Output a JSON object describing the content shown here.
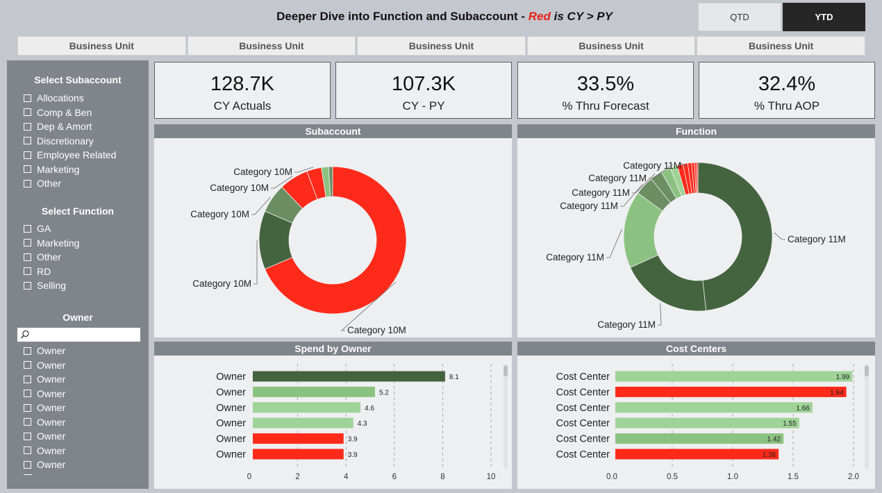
{
  "header": {
    "title_prefix": "Deeper Dive into Function and Subaccount - ",
    "title_red": "Red",
    "title_mid": " is CY > PY",
    "qtd_label": "QTD",
    "ytd_label": "YTD"
  },
  "business_units": [
    "Business Unit",
    "Business Unit",
    "Business Unit",
    "Business Unit",
    "Business Unit"
  ],
  "sidebar": {
    "subaccount_header": "Select Subaccount",
    "subaccounts": [
      "Allocations",
      "Comp & Ben",
      "Dep & Amort",
      "Discretionary",
      "Employee Related",
      "Marketing",
      "Other"
    ],
    "function_header": "Select Function",
    "functions": [
      "GA",
      "Marketing",
      "Other",
      "RD",
      "Selling"
    ],
    "owner_header": "Owner",
    "owner_search_placeholder": "",
    "owners": [
      "Owner",
      "Owner",
      "Owner",
      "Owner",
      "Owner",
      "Owner",
      "Owner",
      "Owner",
      "Owner"
    ]
  },
  "kpis": [
    {
      "value": "128.7K",
      "label": "CY Actuals"
    },
    {
      "value": "107.3K",
      "label": "CY - PY"
    },
    {
      "value": "33.5%",
      "label": "% Thru Forecast"
    },
    {
      "value": "32.4%",
      "label": "% Thru AOP"
    }
  ],
  "panels": {
    "subaccount_title": "Subaccount",
    "function_title": "Function",
    "owner_title": "Spend by Owner",
    "cost_title": "Cost Centers"
  },
  "colors": {
    "red": "#ff2a1a",
    "dark_green": "#44643f",
    "mid_green": "#6b8f63",
    "light_green": "#8cc281",
    "pale_green": "#9fd397"
  },
  "chart_data": [
    {
      "type": "pie",
      "title": "Subaccount",
      "labels": [
        "Category 10M",
        "Category 10M",
        "Category 10M",
        "Category 10M",
        "Category 10M",
        "Category 10M",
        "Category 10M"
      ],
      "values": [
        64,
        12,
        6,
        6,
        3,
        1.5,
        0.8
      ],
      "colors": [
        "#ff2a1a",
        "#44643f",
        "#6b8f63",
        "#ff2a1a",
        "#ff2a1a",
        "#8cc281",
        "#6b8f63"
      ]
    },
    {
      "type": "pie",
      "title": "Function",
      "labels": [
        "Category 11M",
        "Category 11M",
        "Category 11M",
        "Category 11M",
        "Category 11M",
        "Category 11M",
        "Category 11M",
        "Category 11M"
      ],
      "values": [
        46,
        19,
        16,
        4,
        2.5,
        2,
        1.5,
        1.2,
        1,
        0.8,
        0.6,
        0.4,
        0.3
      ],
      "colors": [
        "#44643f",
        "#44643f",
        "#8cc281",
        "#6b8f63",
        "#6b8f63",
        "#8cc281",
        "#9fd397",
        "#ff2a1a",
        "#ff2a1a",
        "#ff2a1a",
        "#ff2a1a",
        "#ff2a1a",
        "#ff2a1a"
      ]
    },
    {
      "type": "bar",
      "title": "Spend by Owner",
      "categories": [
        "Owner",
        "Owner",
        "Owner",
        "Owner",
        "Owner",
        "Owner"
      ],
      "values": [
        8.1,
        5.2,
        4.6,
        4.3,
        3.9,
        3.9
      ],
      "colors": [
        "#44643f",
        "#8cc281",
        "#9fd397",
        "#9fd397",
        "#ff2a1a",
        "#ff2a1a"
      ],
      "xlim": [
        0,
        10
      ],
      "ticks": [
        0,
        2,
        4,
        6,
        8,
        10
      ]
    },
    {
      "type": "bar",
      "title": "Cost Centers",
      "categories": [
        "Cost Center",
        "Cost Center",
        "Cost Center",
        "Cost Center",
        "Cost Center",
        "Cost Center"
      ],
      "values": [
        1.99,
        1.94,
        1.66,
        1.55,
        1.42,
        1.38
      ],
      "colors": [
        "#9fd397",
        "#ff2a1a",
        "#9fd397",
        "#9fd397",
        "#8cc281",
        "#ff2a1a"
      ],
      "xlim": [
        0,
        2.0
      ],
      "ticks": [
        "0.0",
        "0.5",
        "1.0",
        "1.5",
        "2.0"
      ]
    }
  ]
}
